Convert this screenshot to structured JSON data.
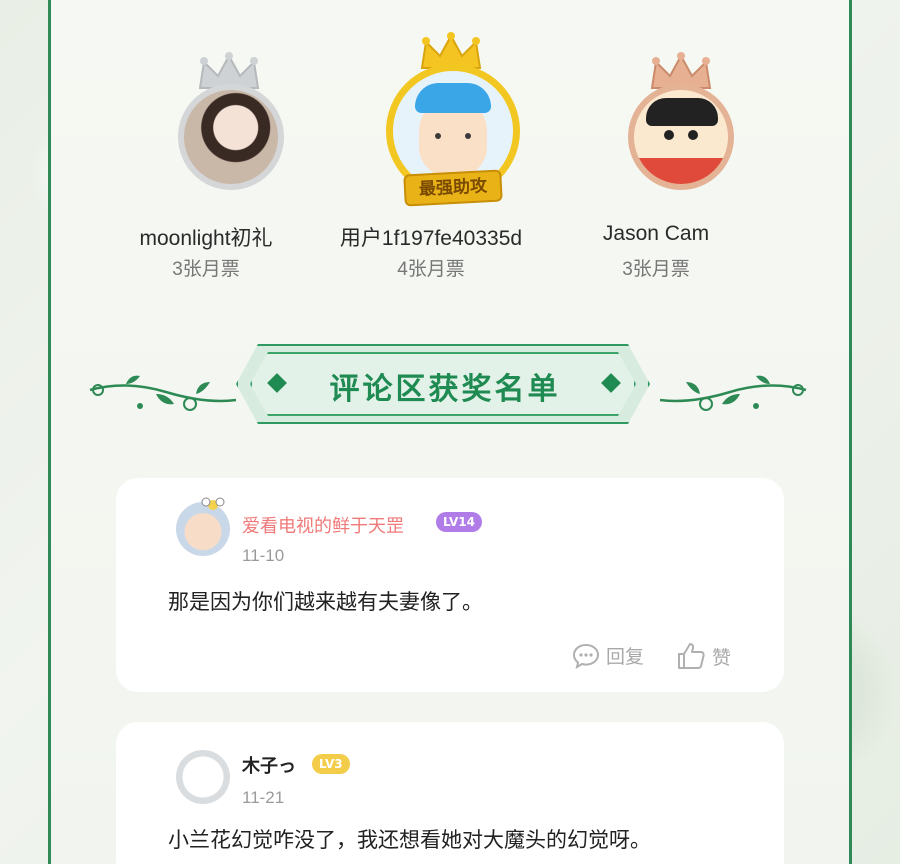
{
  "podium": [
    {
      "rank": "2",
      "name": "moonlight初礼",
      "votes": "3张月票",
      "crown": "silver"
    },
    {
      "rank": "1",
      "name": "用户1f197fe40335d",
      "votes": "4张月票",
      "crown": "gold",
      "badge": "最强助攻"
    },
    {
      "rank": "3",
      "name": "Jason Cam",
      "votes": "3张月票",
      "crown": "bronze"
    }
  ],
  "section_title": "评论区获奖名单",
  "comments": [
    {
      "user": "爱看电视的鲜于天罡",
      "level": "LV14",
      "date": "11-10",
      "text": "那是因为你们越来越有夫妻像了。",
      "reply_label": "回复",
      "like_label": "赞",
      "name_color": "#f07a7a",
      "level_color": "#b07ce8"
    },
    {
      "user": "木子っ",
      "level": "LV3",
      "date": "11-21",
      "text": "小兰花幻觉咋没了，我还想看她对大魔头的幻觉呀。",
      "name_color": "#222222",
      "level_color": "#f3cd4a"
    }
  ],
  "colors": {
    "accent": "#1f8a52",
    "border": "#2f8a5a"
  }
}
